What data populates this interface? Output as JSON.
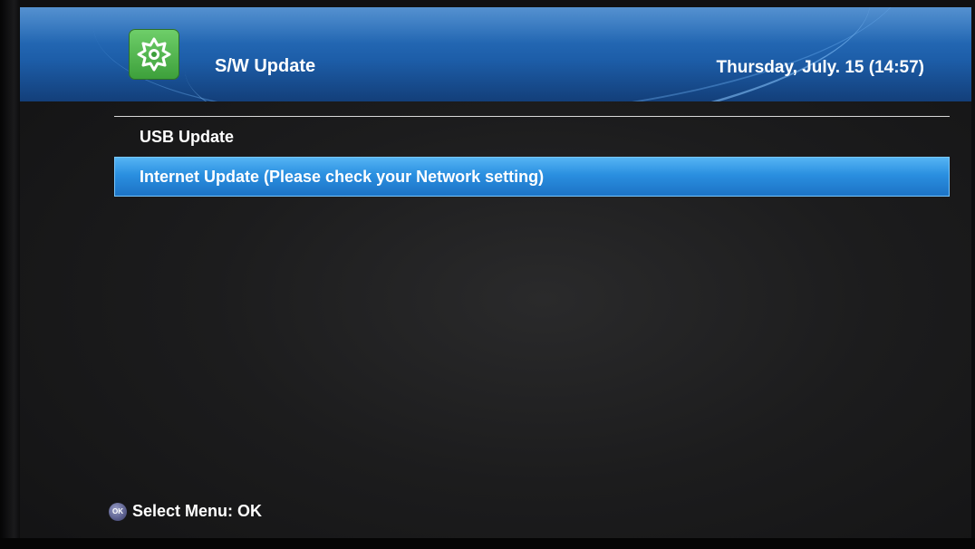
{
  "header": {
    "title": "S/W Update",
    "datetime": "Thursday, July. 15 (14:57)",
    "app_icon": "update-gear-icon"
  },
  "menu": {
    "items": [
      {
        "label": "USB Update",
        "selected": false
      },
      {
        "label": "Internet Update (Please check your Network setting)",
        "selected": true
      }
    ]
  },
  "footer": {
    "ok_icon_label": "OK",
    "hint": "Select Menu: OK"
  },
  "colors": {
    "header_blue": "#1d5ea9",
    "selection_blue": "#2a8fe0",
    "icon_green": "#3c9f3a"
  }
}
